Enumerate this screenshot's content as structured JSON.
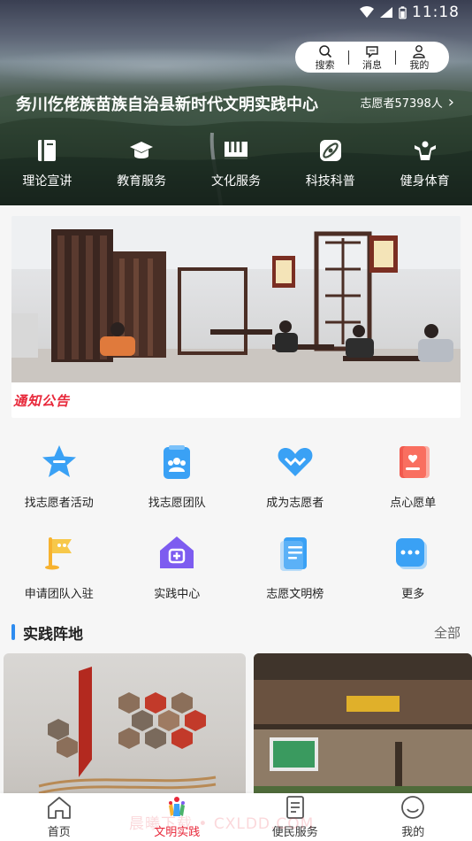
{
  "status": {
    "time": "11:18"
  },
  "topbar": {
    "search_label": "搜索",
    "message_label": "消息",
    "mine_label": "我的"
  },
  "header": {
    "title": "务川仡佬族苗族自治县新时代文明实践中心",
    "volunteers": "志愿者57398人"
  },
  "categories": [
    {
      "label": "理论宣讲",
      "icon": "book-icon"
    },
    {
      "label": "教育服务",
      "icon": "graduation-cap-icon"
    },
    {
      "label": "文化服务",
      "icon": "piano-icon"
    },
    {
      "label": "科技科普",
      "icon": "atom-icon"
    },
    {
      "label": "健身体育",
      "icon": "fitness-icon"
    }
  ],
  "banner": {
    "notice": "通知公告"
  },
  "services": [
    {
      "label": "找志愿者活动",
      "icon": "star-icon"
    },
    {
      "label": "找志愿团队",
      "icon": "team-icon"
    },
    {
      "label": "成为志愿者",
      "icon": "heart-icon"
    },
    {
      "label": "点心愿单",
      "icon": "wish-list-icon"
    },
    {
      "label": "申请团队入驻",
      "icon": "flag-icon"
    },
    {
      "label": "实践中心",
      "icon": "home-icon"
    },
    {
      "label": "志愿文明榜",
      "icon": "document-icon"
    },
    {
      "label": "更多",
      "icon": "more-icon"
    }
  ],
  "section": {
    "title": "实践阵地",
    "all_label": "全部"
  },
  "bottom_nav": [
    {
      "label": "首页",
      "icon": "home-nav-icon"
    },
    {
      "label": "文明实践",
      "icon": "civilization-icon"
    },
    {
      "label": "便民服务",
      "icon": "service-doc-icon"
    },
    {
      "label": "我的",
      "icon": "profile-icon"
    }
  ],
  "watermark": "晨曦下载 • CXLDD.COM",
  "colors": {
    "accent": "#e8283a",
    "blue": "#2e8cf0",
    "icon_blue": "#3a9bf5"
  }
}
